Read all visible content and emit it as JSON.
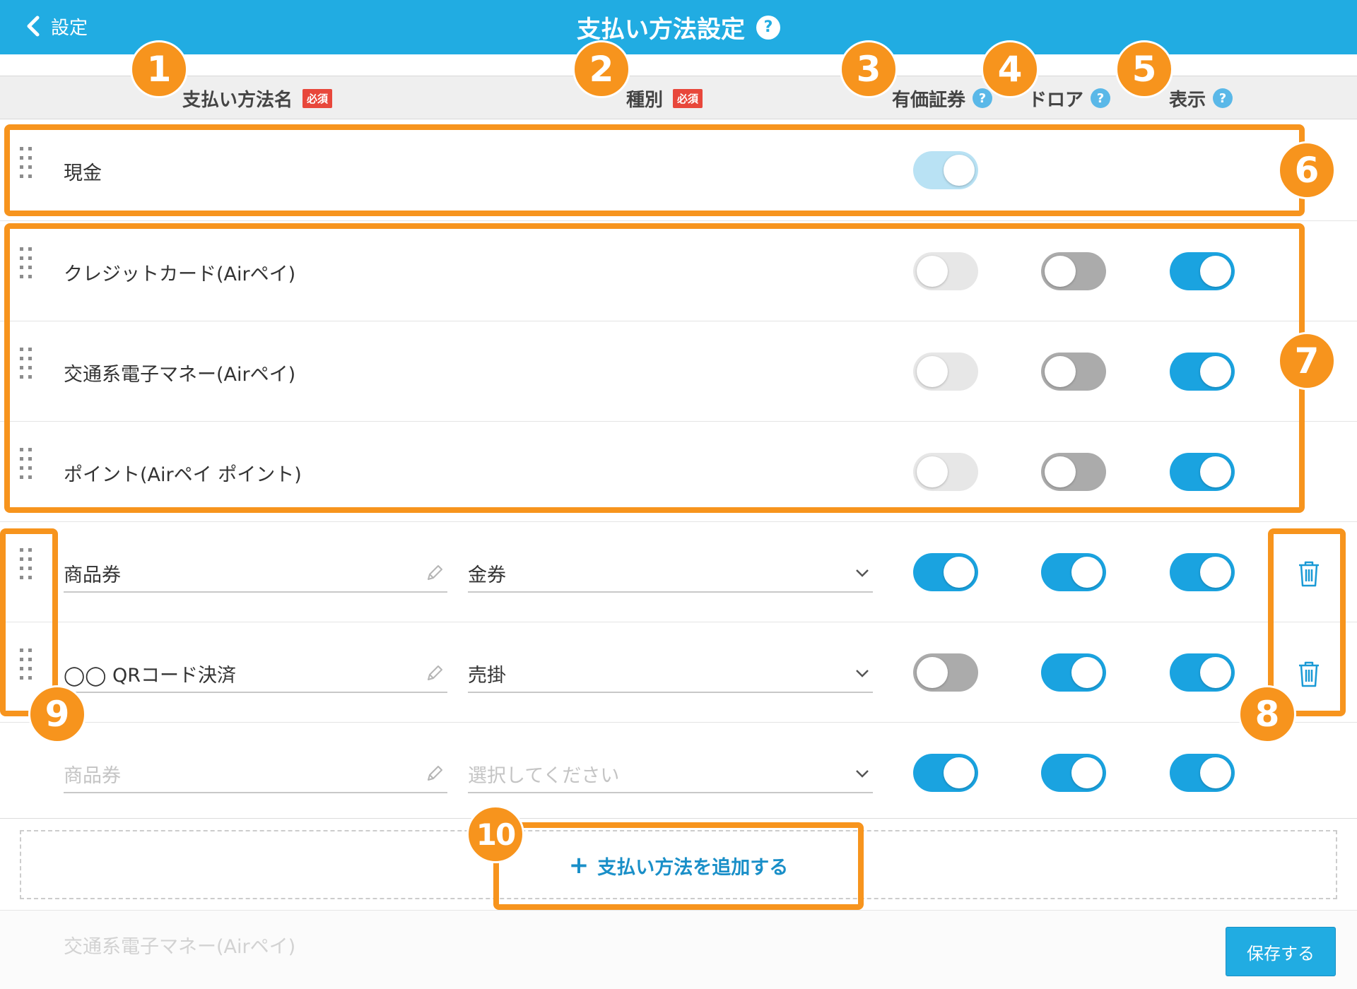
{
  "header": {
    "back_label": "設定",
    "title": "支払い方法設定",
    "help": "?"
  },
  "columns": {
    "name": "支払い方法名",
    "type": "種別",
    "required": "必須",
    "voucher": "有価証券",
    "drawer": "ドロア",
    "display": "表示",
    "help": "?"
  },
  "rows": [
    {
      "name": "現金",
      "voucher": "on-disabled"
    },
    {
      "name": "クレジットカード(Airペイ)",
      "voucher": "off-disabled",
      "drawer": "off",
      "display": "on"
    },
    {
      "name": "交通系電子マネー(Airペイ)",
      "voucher": "off-disabled",
      "drawer": "off",
      "display": "on"
    },
    {
      "name": "ポイント(Airペイ ポイント)",
      "voucher": "off-disabled",
      "drawer": "off",
      "display": "on"
    },
    {
      "name": "商品券",
      "type": "金券",
      "voucher": "on",
      "drawer": "on",
      "display": "on"
    },
    {
      "name": "◯◯ QRコード決済",
      "type": "売掛",
      "voucher": "off",
      "drawer": "on",
      "display": "on"
    },
    {
      "name_placeholder": "商品券",
      "type_placeholder": "選択してください",
      "voucher": "on",
      "drawer": "on",
      "display": "on"
    }
  ],
  "add_button": {
    "icon": "+",
    "label": "支払い方法を追加する"
  },
  "footer": {
    "faded_text": "交通系電子マネー(Airペイ)",
    "save_label": "保存する"
  },
  "annotations": [
    "1",
    "2",
    "3",
    "4",
    "5",
    "6",
    "7",
    "8",
    "9",
    "10"
  ],
  "colors": {
    "header": "#21ace2",
    "toggle_on": "#1aa3e0",
    "toggle_off": "#ababab",
    "highlight": "#f7941d",
    "required_badge": "#e8473b"
  }
}
